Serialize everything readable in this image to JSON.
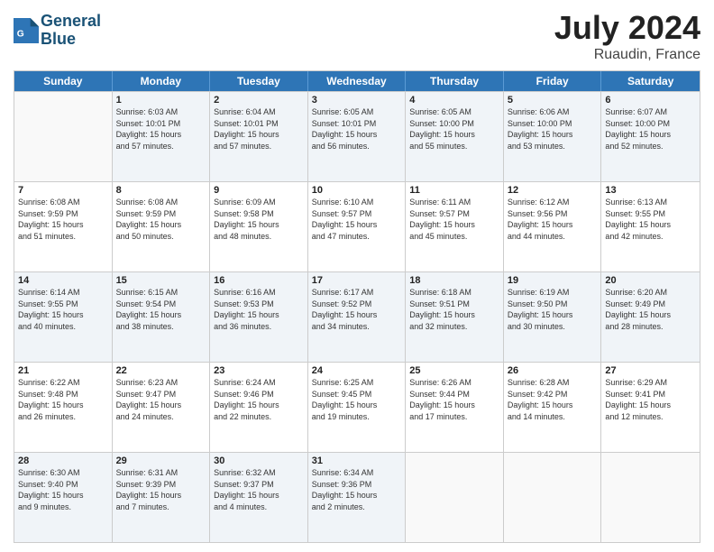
{
  "header": {
    "logo_line1": "General",
    "logo_line2": "Blue",
    "title": "July 2024",
    "subtitle": "Ruaudin, France"
  },
  "calendar": {
    "days": [
      "Sunday",
      "Monday",
      "Tuesday",
      "Wednesday",
      "Thursday",
      "Friday",
      "Saturday"
    ],
    "rows": [
      [
        {
          "day": "",
          "empty": true
        },
        {
          "day": "1",
          "rise": "6:03 AM",
          "set": "10:01 PM",
          "daylight": "15 hours and 57 minutes."
        },
        {
          "day": "2",
          "rise": "6:04 AM",
          "set": "10:01 PM",
          "daylight": "15 hours and 57 minutes."
        },
        {
          "day": "3",
          "rise": "6:05 AM",
          "set": "10:01 PM",
          "daylight": "15 hours and 56 minutes."
        },
        {
          "day": "4",
          "rise": "6:05 AM",
          "set": "10:00 PM",
          "daylight": "15 hours and 55 minutes."
        },
        {
          "day": "5",
          "rise": "6:06 AM",
          "set": "10:00 PM",
          "daylight": "15 hours and 53 minutes."
        },
        {
          "day": "6",
          "rise": "6:07 AM",
          "set": "10:00 PM",
          "daylight": "15 hours and 52 minutes."
        }
      ],
      [
        {
          "day": "7",
          "rise": "6:08 AM",
          "set": "9:59 PM",
          "daylight": "15 hours and 51 minutes."
        },
        {
          "day": "8",
          "rise": "6:08 AM",
          "set": "9:59 PM",
          "daylight": "15 hours and 50 minutes."
        },
        {
          "day": "9",
          "rise": "6:09 AM",
          "set": "9:58 PM",
          "daylight": "15 hours and 48 minutes."
        },
        {
          "day": "10",
          "rise": "6:10 AM",
          "set": "9:57 PM",
          "daylight": "15 hours and 47 minutes."
        },
        {
          "day": "11",
          "rise": "6:11 AM",
          "set": "9:57 PM",
          "daylight": "15 hours and 45 minutes."
        },
        {
          "day": "12",
          "rise": "6:12 AM",
          "set": "9:56 PM",
          "daylight": "15 hours and 44 minutes."
        },
        {
          "day": "13",
          "rise": "6:13 AM",
          "set": "9:55 PM",
          "daylight": "15 hours and 42 minutes."
        }
      ],
      [
        {
          "day": "14",
          "rise": "6:14 AM",
          "set": "9:55 PM",
          "daylight": "15 hours and 40 minutes."
        },
        {
          "day": "15",
          "rise": "6:15 AM",
          "set": "9:54 PM",
          "daylight": "15 hours and 38 minutes."
        },
        {
          "day": "16",
          "rise": "6:16 AM",
          "set": "9:53 PM",
          "daylight": "15 hours and 36 minutes."
        },
        {
          "day": "17",
          "rise": "6:17 AM",
          "set": "9:52 PM",
          "daylight": "15 hours and 34 minutes."
        },
        {
          "day": "18",
          "rise": "6:18 AM",
          "set": "9:51 PM",
          "daylight": "15 hours and 32 minutes."
        },
        {
          "day": "19",
          "rise": "6:19 AM",
          "set": "9:50 PM",
          "daylight": "15 hours and 30 minutes."
        },
        {
          "day": "20",
          "rise": "6:20 AM",
          "set": "9:49 PM",
          "daylight": "15 hours and 28 minutes."
        }
      ],
      [
        {
          "day": "21",
          "rise": "6:22 AM",
          "set": "9:48 PM",
          "daylight": "15 hours and 26 minutes."
        },
        {
          "day": "22",
          "rise": "6:23 AM",
          "set": "9:47 PM",
          "daylight": "15 hours and 24 minutes."
        },
        {
          "day": "23",
          "rise": "6:24 AM",
          "set": "9:46 PM",
          "daylight": "15 hours and 22 minutes."
        },
        {
          "day": "24",
          "rise": "6:25 AM",
          "set": "9:45 PM",
          "daylight": "15 hours and 19 minutes."
        },
        {
          "day": "25",
          "rise": "6:26 AM",
          "set": "9:44 PM",
          "daylight": "15 hours and 17 minutes."
        },
        {
          "day": "26",
          "rise": "6:28 AM",
          "set": "9:42 PM",
          "daylight": "15 hours and 14 minutes."
        },
        {
          "day": "27",
          "rise": "6:29 AM",
          "set": "9:41 PM",
          "daylight": "15 hours and 12 minutes."
        }
      ],
      [
        {
          "day": "28",
          "rise": "6:30 AM",
          "set": "9:40 PM",
          "daylight": "15 hours and 9 minutes."
        },
        {
          "day": "29",
          "rise": "6:31 AM",
          "set": "9:39 PM",
          "daylight": "15 hours and 7 minutes."
        },
        {
          "day": "30",
          "rise": "6:32 AM",
          "set": "9:37 PM",
          "daylight": "15 hours and 4 minutes."
        },
        {
          "day": "31",
          "rise": "6:34 AM",
          "set": "9:36 PM",
          "daylight": "15 hours and 2 minutes."
        },
        {
          "day": "",
          "empty": true
        },
        {
          "day": "",
          "empty": true
        },
        {
          "day": "",
          "empty": true
        }
      ]
    ]
  }
}
